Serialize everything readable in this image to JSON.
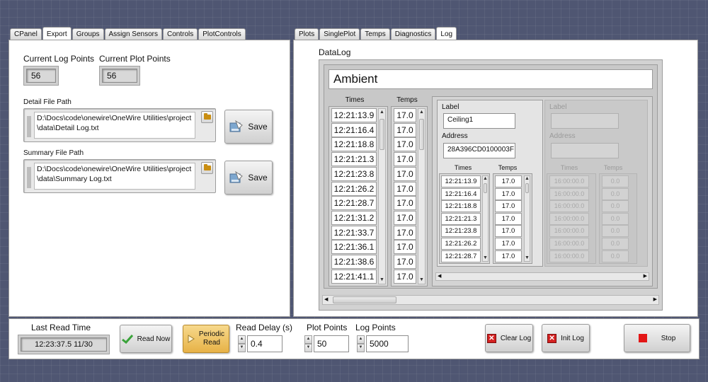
{
  "left_tabs": [
    "CPanel",
    "Export",
    "Groups",
    "Assign Sensors",
    "Controls",
    "PlotControls"
  ],
  "right_tabs": [
    "Plots",
    "SinglePlot",
    "Temps",
    "Diagnostics",
    "Log"
  ],
  "export": {
    "current_log_points_label": "Current Log Points",
    "current_log_points": "56",
    "current_plot_points_label": "Current Plot Points",
    "current_plot_points": "56",
    "detail_path_label": "Detail File Path",
    "detail_path": "D:\\Docs\\code\\onewire\\OneWire Utilities\\project\\data\\Detail Log.txt",
    "summary_path_label": "Summary File Path",
    "summary_path": "D:\\Docs\\code\\onewire\\OneWire Utilities\\project\\data\\Summary Log.txt",
    "save_label": "Save"
  },
  "log": {
    "title": "DataLog",
    "group_name": "Ambient",
    "times_header": "Times",
    "temps_header": "Temps",
    "times": [
      "12:21:13.9",
      "12:21:16.4",
      "12:21:18.8",
      "12:21:21.3",
      "12:21:23.8",
      "12:21:26.2",
      "12:21:28.7",
      "12:21:31.2",
      "12:21:33.7",
      "12:21:36.1",
      "12:21:38.6",
      "12:21:41.1"
    ],
    "temps": [
      "17.0",
      "17.0",
      "17.0",
      "17.0",
      "17.0",
      "17.0",
      "17.0",
      "17.0",
      "17.0",
      "17.0",
      "17.0",
      "17.0"
    ],
    "sensor1": {
      "label_caption": "Label",
      "label": "Ceiling1",
      "address_caption": "Address",
      "address": "28A396CD0100003F",
      "times": [
        "12:21:13.9",
        "12:21:16.4",
        "12:21:18.8",
        "12:21:21.3",
        "12:21:23.8",
        "12:21:26.2",
        "12:21:28.7"
      ],
      "temps": [
        "17.0",
        "17.0",
        "17.0",
        "17.0",
        "17.0",
        "17.0",
        "17.0"
      ]
    },
    "sensor2": {
      "label_caption": "Label",
      "address_caption": "Address",
      "times": [
        "16:00:00.0",
        "16:00:00.0",
        "16:00:00.0",
        "16:00:00.0",
        "16:00:00.0",
        "16:00:00.0",
        "16:00:00.0"
      ],
      "temps": [
        "0.0",
        "0.0",
        "0.0",
        "0.0",
        "0.0",
        "0.0",
        "0.0"
      ]
    }
  },
  "bottom": {
    "last_read_label": "Last Read Time",
    "last_read_value": "12:23:37.5 11/30",
    "read_now_label": "Read Now",
    "periodic_read_label": "Periodic\nRead",
    "read_delay_label": "Read Delay (s)",
    "read_delay_value": "0.4",
    "plot_points_label": "Plot Points",
    "plot_points_value": "50",
    "log_points_label": "Log Points",
    "log_points_value": "5000",
    "clear_log_label": "Clear Log",
    "init_log_label": "Init Log",
    "stop_label": "Stop"
  },
  "colors": {
    "stop_red": "#e31616",
    "clear_red": "#d42121",
    "periodic_gold": "#f0c25a",
    "read_now_green": "#3aa33a"
  }
}
